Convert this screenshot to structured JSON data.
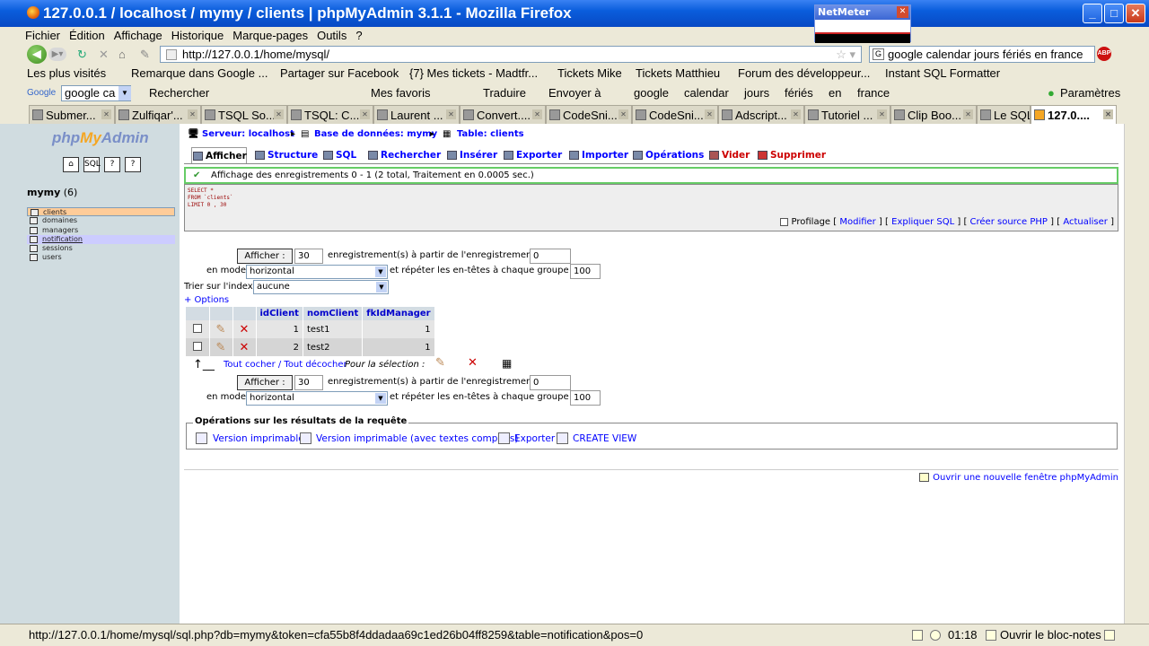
{
  "window": {
    "title": "127.0.0.1 / localhost / mymy / clients | phpMyAdmin 3.1.1 - Mozilla Firefox"
  },
  "netmeter": {
    "title": "NetMeter"
  },
  "menu": [
    "Fichier",
    "Édition",
    "Affichage",
    "Historique",
    "Marque-pages",
    "Outils",
    "?"
  ],
  "nav": {
    "url": "http://127.0.0.1/home/mysql/",
    "search": "google calendar jours fériés en france"
  },
  "bookmarks": [
    "Les plus visités",
    "Remarque dans Google ...",
    "Partager sur Facebook",
    "{7} Mes tickets - Madtfr...",
    "Tickets Mike",
    "Tickets Matthieu",
    "Forum des développeur...",
    "Instant SQL Formatter"
  ],
  "google_bar": {
    "search_value": "google ca",
    "items": [
      "Rechercher",
      "Mes favoris",
      "Traduire",
      "Envoyer à",
      "google",
      "calendar",
      "jours",
      "fériés",
      "en",
      "france"
    ],
    "settings": "Paramètres"
  },
  "tabs": [
    "Submer...",
    "Zulfiqar'...",
    "TSQL So...",
    "TSQL: C...",
    "Laurent ...",
    "Convert....",
    "CodeSni...",
    "CodeSni...",
    "Adscript...",
    "Tutoriel ...",
    "Clip Boo...",
    "Le SQL ...",
    "127.0...."
  ],
  "left": {
    "db_name": "mymy",
    "db_count": "(6)",
    "tables": [
      "clients",
      "domaines",
      "managers",
      "notification",
      "sessions",
      "users"
    ]
  },
  "breadcrumb": {
    "server": "Serveur: localhost",
    "database": "Base de données: mymy",
    "table": "Table: clients"
  },
  "pma_tabs": [
    "Afficher",
    "Structure",
    "SQL",
    "Rechercher",
    "Insérer",
    "Exporter",
    "Importer",
    "Opérations",
    "Vider",
    "Supprimer"
  ],
  "message": "Affichage des enregistrements 0 - 1 (2 total, Traitement en 0.0005 sec.)",
  "sql": [
    "SELECT *",
    "FROM `clients`",
    "LIMIT 0 , 30"
  ],
  "sql_links": {
    "profilage": "Profilage",
    "modifier": "Modifier",
    "expliquer": "Expliquer SQL",
    "php": "Créer source PHP",
    "actualiser": "Actualiser"
  },
  "nav_form": {
    "show_button": "Afficher :",
    "rows": "30",
    "from_label": "enregistrement(s) à partir de l'enregistrement n°",
    "start_top": "0",
    "start_bottom": "0",
    "mode_label": "en mode",
    "mode_value": "horizontal",
    "repeat_label": "et répéter les en-têtes à chaque groupe de",
    "repeat": "100",
    "sort_label": "Trier sur l'index:",
    "sort_value": "aucune",
    "options": "+ Options"
  },
  "table": {
    "columns": [
      "idClient",
      "nomClient",
      "fkIdManager"
    ],
    "rows": [
      [
        "1",
        "test1",
        "1"
      ],
      [
        "2",
        "test2",
        "1"
      ]
    ]
  },
  "check_all": "Tout cocher / Tout décocher",
  "for_selection": "Pour la sélection :",
  "operations": {
    "legend": "Opérations sur les résultats de la requête",
    "items": [
      "Version imprimable",
      "Version imprimable (avec textes complets)",
      "Exporter",
      "CREATE VIEW"
    ]
  },
  "new_window": "Ouvrir une nouvelle fenêtre phpMyAdmin",
  "status": {
    "url": "http://127.0.0.1/home/mysql/sql.php?db=mymy&token=cfa55b8f4ddadaa69c1ed26b04ff8259&table=notification&pos=0",
    "time": "01:18",
    "notepad": "Ouvrir le bloc-notes"
  }
}
